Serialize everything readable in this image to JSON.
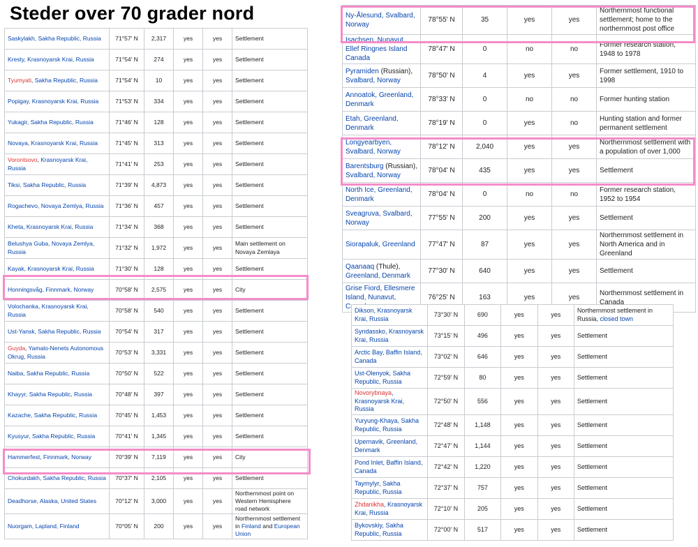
{
  "title": "Steder over 70 grader nord",
  "left_table": [
    {
      "parts": [
        {
          "t": "Saskylakh, Sakha Republic, Russia",
          "k": "link"
        }
      ],
      "lat": "71°57' N",
      "pop": "2,317",
      "a": "yes",
      "b": "yes",
      "note": [
        {
          "t": "Settlement",
          "k": "plain"
        }
      ]
    },
    {
      "parts": [
        {
          "t": "Kresty, Krasnoyarsk Krai, Russia",
          "k": "link"
        }
      ],
      "lat": "71°54' N",
      "pop": "274",
      "a": "yes",
      "b": "yes",
      "note": [
        {
          "t": "Settlement",
          "k": "plain"
        }
      ]
    },
    {
      "parts": [
        {
          "t": "Tyumyati",
          "k": "red"
        },
        {
          "t": ", Sakha Republic, Russia",
          "k": "link"
        }
      ],
      "lat": "71°54' N",
      "pop": "10",
      "a": "yes",
      "b": "yes",
      "note": [
        {
          "t": "Settlement",
          "k": "plain"
        }
      ]
    },
    {
      "parts": [
        {
          "t": "Popigay, Krasnoyarsk Krai, Russia",
          "k": "link"
        }
      ],
      "lat": "71°53' N",
      "pop": "334",
      "a": "yes",
      "b": "yes",
      "note": [
        {
          "t": "Settlement",
          "k": "plain"
        }
      ]
    },
    {
      "parts": [
        {
          "t": "Yukagir, Sakha Republic, Russia",
          "k": "link"
        }
      ],
      "lat": "71°46' N",
      "pop": "128",
      "a": "yes",
      "b": "yes",
      "note": [
        {
          "t": "Settlement",
          "k": "plain"
        }
      ]
    },
    {
      "parts": [
        {
          "t": "Novaya, Krasnoyarsk Krai, Russia",
          "k": "link"
        }
      ],
      "lat": "71°45' N",
      "pop": "313",
      "a": "yes",
      "b": "yes",
      "note": [
        {
          "t": "Settlement",
          "k": "plain"
        }
      ]
    },
    {
      "parts": [
        {
          "t": "Vorontsovo",
          "k": "red"
        },
        {
          "t": ", Krasnoyarsk Krai, Russia",
          "k": "link"
        }
      ],
      "lat": "71°41' N",
      "pop": "253",
      "a": "yes",
      "b": "yes",
      "note": [
        {
          "t": "Settlement",
          "k": "plain"
        }
      ]
    },
    {
      "parts": [
        {
          "t": "Tiksi, Sakha Republic, Russia",
          "k": "link"
        }
      ],
      "lat": "71°39' N",
      "pop": "4,873",
      "a": "yes",
      "b": "yes",
      "note": [
        {
          "t": "Settlement",
          "k": "plain"
        }
      ]
    },
    {
      "parts": [
        {
          "t": "Rogachevo, Novaya Zemlya, Russia",
          "k": "link"
        }
      ],
      "lat": "71°36' N",
      "pop": "457",
      "a": "yes",
      "b": "yes",
      "note": [
        {
          "t": "Settlement",
          "k": "plain"
        }
      ]
    },
    {
      "parts": [
        {
          "t": "Kheta, Krasnoyarsk Krai, Russia",
          "k": "link"
        }
      ],
      "lat": "71°34' N",
      "pop": "368",
      "a": "yes",
      "b": "yes",
      "note": [
        {
          "t": "Settlement",
          "k": "plain"
        }
      ]
    },
    {
      "parts": [
        {
          "t": "Belushya Guba, Novaya Zemlya, Russia",
          "k": "link"
        }
      ],
      "lat": "71°32' N",
      "pop": "1,972",
      "a": "yes",
      "b": "yes",
      "note": [
        {
          "t": "Main settlement on Novaya Zemlaya",
          "k": "plain"
        }
      ]
    },
    {
      "parts": [
        {
          "t": "Kayak, Krasnoyarsk Krai, Russia",
          "k": "link"
        }
      ],
      "lat": "71°30' N",
      "pop": "128",
      "a": "yes",
      "b": "yes",
      "note": [
        {
          "t": "Settlement",
          "k": "plain"
        }
      ]
    },
    {
      "parts": [
        {
          "t": "Honningsvåg, Finnmark, Norway",
          "k": "link"
        }
      ],
      "lat": "70°58' N",
      "pop": "2,575",
      "a": "yes",
      "b": "yes",
      "note": [
        {
          "t": "City",
          "k": "plain"
        }
      ]
    },
    {
      "parts": [
        {
          "t": "Volochanka, Krasnoyarsk Krai, Russia",
          "k": "link"
        }
      ],
      "lat": "70°58' N",
      "pop": "540",
      "a": "yes",
      "b": "yes",
      "note": [
        {
          "t": "Settlement",
          "k": "plain"
        }
      ]
    },
    {
      "parts": [
        {
          "t": "Ust-Yansk, Sakha Republic, Russia",
          "k": "link"
        }
      ],
      "lat": "70°54' N",
      "pop": "317",
      "a": "yes",
      "b": "yes",
      "note": [
        {
          "t": "Settlement",
          "k": "plain"
        }
      ]
    },
    {
      "parts": [
        {
          "t": "Guyda",
          "k": "red"
        },
        {
          "t": ", Yamalo-Nenets Autonomous Okrug, Russia",
          "k": "link"
        }
      ],
      "lat": "70°53' N",
      "pop": "3,331",
      "a": "yes",
      "b": "yes",
      "note": [
        {
          "t": "Settlement",
          "k": "plain"
        }
      ]
    },
    {
      "parts": [
        {
          "t": "Naiba, Sakha Republic, Russia",
          "k": "link"
        }
      ],
      "lat": "70°50' N",
      "pop": "522",
      "a": "yes",
      "b": "yes",
      "note": [
        {
          "t": "Settlement",
          "k": "plain"
        }
      ]
    },
    {
      "parts": [
        {
          "t": "Khayyr, Sakha Republic, Russia",
          "k": "link"
        }
      ],
      "lat": "70°48' N",
      "pop": "397",
      "a": "yes",
      "b": "yes",
      "note": [
        {
          "t": "Settlement",
          "k": "plain"
        }
      ]
    },
    {
      "parts": [
        {
          "t": "Kazache, Sakha Republic, Russia",
          "k": "link"
        }
      ],
      "lat": "70°45' N",
      "pop": "1,453",
      "a": "yes",
      "b": "yes",
      "note": [
        {
          "t": "Settlement",
          "k": "plain"
        }
      ]
    },
    {
      "parts": [
        {
          "t": "Kyusyur, Sakha Republic, Russia",
          "k": "link"
        }
      ],
      "lat": "70°41' N",
      "pop": "1,345",
      "a": "yes",
      "b": "yes",
      "note": [
        {
          "t": "Settlement",
          "k": "plain"
        }
      ]
    },
    {
      "parts": [
        {
          "t": "Hammerfest, Finnmark, Norway",
          "k": "link"
        }
      ],
      "lat": "70°39' N",
      "pop": "7,119",
      "a": "yes",
      "b": "yes",
      "note": [
        {
          "t": "City",
          "k": "plain"
        }
      ]
    },
    {
      "parts": [
        {
          "t": "Chokurdakh, Sakha Republic, Russia",
          "k": "link"
        }
      ],
      "lat": "70°37' N",
      "pop": "2,105",
      "a": "yes",
      "b": "yes",
      "note": [
        {
          "t": "Settlement",
          "k": "plain"
        }
      ]
    },
    {
      "parts": [
        {
          "t": "Deadhorse, Alaska, United States",
          "k": "link"
        }
      ],
      "lat": "70°12' N",
      "pop": "3,000",
      "a": "yes",
      "b": "yes",
      "note": [
        {
          "t": "Northernmost point on Western Hemisphere road network",
          "k": "plain"
        }
      ]
    },
    {
      "parts": [
        {
          "t": "Nuorgam, Lapland, Finland",
          "k": "link"
        }
      ],
      "lat": "70°05' N",
      "pop": "200",
      "a": "yes",
      "b": "yes",
      "note": [
        {
          "t": "Northernmost settlement in ",
          "k": "plain"
        },
        {
          "t": "Finland",
          "k": "link"
        },
        {
          "t": " and ",
          "k": "plain"
        },
        {
          "t": "European Union",
          "k": "link"
        }
      ]
    }
  ],
  "top_right_table": [
    {
      "parts": [
        {
          "t": "Ny-Ålesund, Svalbard, Norway",
          "k": "link"
        }
      ],
      "lat": "78°55' N",
      "pop": "35",
      "a": "yes",
      "b": "yes",
      "note": [
        {
          "t": "Northernmost functional settlement; home to the northernmost post office",
          "k": "plain"
        }
      ]
    },
    {
      "parts": [
        {
          "t": "Isachsen, Nunavut, Ellef Ringnes Island Canada",
          "k": "link"
        }
      ],
      "lat": "78°47' N",
      "pop": "0",
      "a": "no",
      "b": "no",
      "note": [
        {
          "t": "Former research station, 1948 to 1978",
          "k": "plain"
        }
      ]
    },
    {
      "parts": [
        {
          "t": "Pyramiden",
          "k": "link"
        },
        {
          "t": " (Russian), ",
          "k": "plain"
        },
        {
          "t": "Svalbard, Norway",
          "k": "link"
        }
      ],
      "lat": "78°50' N",
      "pop": "4",
      "a": "yes",
      "b": "yes",
      "note": [
        {
          "t": "Former settlement, 1910 to 1998",
          "k": "plain"
        }
      ]
    },
    {
      "parts": [
        {
          "t": "Annoatok, Greenland, Denmark",
          "k": "link"
        }
      ],
      "lat": "78°33' N",
      "pop": "0",
      "a": "no",
      "b": "no",
      "note": [
        {
          "t": "Former hunting station",
          "k": "plain"
        }
      ]
    },
    {
      "parts": [
        {
          "t": "Etah, Greenland, Denmark",
          "k": "link"
        }
      ],
      "lat": "78°19' N",
      "pop": "0",
      "a": "yes",
      "b": "no",
      "note": [
        {
          "t": "Hunting station and former permanent settlement",
          "k": "plain"
        }
      ]
    },
    {
      "parts": [
        {
          "t": "Longyearbyen, Svalbard, Norway",
          "k": "link"
        }
      ],
      "lat": "78°12' N",
      "pop": "2,040",
      "a": "yes",
      "b": "yes",
      "note": [
        {
          "t": "Northernmost settlement with a population of over 1,000",
          "k": "plain"
        }
      ]
    },
    {
      "parts": [
        {
          "t": "Barentsburg",
          "k": "link"
        },
        {
          "t": " (Russian), ",
          "k": "plain"
        },
        {
          "t": "Svalbard, Norway",
          "k": "link"
        }
      ],
      "lat": "78°04' N",
      "pop": "435",
      "a": "yes",
      "b": "yes",
      "note": [
        {
          "t": "Settlement",
          "k": "plain"
        }
      ]
    },
    {
      "parts": [
        {
          "t": "North Ice, Greenland, Denmark",
          "k": "link"
        }
      ],
      "lat": "78°04' N",
      "pop": "0",
      "a": "no",
      "b": "no",
      "note": [
        {
          "t": "Former research station, 1952 to 1954",
          "k": "plain"
        }
      ]
    },
    {
      "parts": [
        {
          "t": "Sveagruva, Svalbard, Norway",
          "k": "link"
        }
      ],
      "lat": "77°55' N",
      "pop": "200",
      "a": "yes",
      "b": "yes",
      "note": [
        {
          "t": "Settlement",
          "k": "plain"
        }
      ]
    },
    {
      "parts": [
        {
          "t": "Siorapaluk, Greenland",
          "k": "link"
        }
      ],
      "lat": "77°47' N",
      "pop": "87",
      "a": "yes",
      "b": "yes",
      "note": [
        {
          "t": "Northernmost settlement in North America and in Greenland",
          "k": "plain"
        }
      ]
    },
    {
      "parts": [
        {
          "t": "Qaanaaq",
          "k": "link"
        },
        {
          "t": " (Thule), ",
          "k": "plain"
        },
        {
          "t": "Greenland, Denmark",
          "k": "link"
        }
      ],
      "lat": "77°30' N",
      "pop": "640",
      "a": "yes",
      "b": "yes",
      "note": [
        {
          "t": "Settlement",
          "k": "plain"
        }
      ]
    },
    {
      "parts": [
        {
          "t": "Grise Fiord, Ellesmere Island, Nunavut, Canada",
          "k": "link"
        }
      ],
      "lat": "76°25' N",
      "pop": "163",
      "a": "yes",
      "b": "yes",
      "note": [
        {
          "t": "Northernmost settlement in Canada",
          "k": "plain"
        }
      ]
    }
  ],
  "bottom_right_table": [
    {
      "parts": [
        {
          "t": "Dikson, Krasnoyarsk Krai, Russia",
          "k": "link"
        }
      ],
      "lat": "73°30' N",
      "pop": "690",
      "a": "yes",
      "b": "yes",
      "note": [
        {
          "t": "Northernmost settlement in Russia, ",
          "k": "plain"
        },
        {
          "t": "closed town",
          "k": "link"
        }
      ]
    },
    {
      "parts": [
        {
          "t": "Syndassko, Krasnoyarsk Krai, Russia",
          "k": "link"
        }
      ],
      "lat": "73°15' N",
      "pop": "496",
      "a": "yes",
      "b": "yes",
      "note": [
        {
          "t": "Settlement",
          "k": "plain"
        }
      ]
    },
    {
      "parts": [
        {
          "t": "Arctic Bay, Baffin Island, Canada",
          "k": "link"
        }
      ],
      "lat": "73°02' N",
      "pop": "646",
      "a": "yes",
      "b": "yes",
      "note": [
        {
          "t": "Settlement",
          "k": "plain"
        }
      ]
    },
    {
      "parts": [
        {
          "t": "Ust-Olenyok, Sakha Republic, Russia",
          "k": "link"
        }
      ],
      "lat": "72°59' N",
      "pop": "80",
      "a": "yes",
      "b": "yes",
      "note": [
        {
          "t": "Settlement",
          "k": "plain"
        }
      ]
    },
    {
      "parts": [
        {
          "t": "Novorybnaya",
          "k": "red"
        },
        {
          "t": ", Krasnoyarsk Krai, Russia",
          "k": "link"
        }
      ],
      "lat": "72°50' N",
      "pop": "556",
      "a": "yes",
      "b": "yes",
      "note": [
        {
          "t": "Settlement",
          "k": "plain"
        }
      ]
    },
    {
      "parts": [
        {
          "t": "Yuryung-Khaya, Sakha Republic, Russia",
          "k": "link"
        }
      ],
      "lat": "72°48' N",
      "pop": "1,148",
      "a": "yes",
      "b": "yes",
      "note": [
        {
          "t": "Settlement",
          "k": "plain"
        }
      ]
    },
    {
      "parts": [
        {
          "t": "Upernavik, Greenland, Denmark",
          "k": "link"
        }
      ],
      "lat": "72°47' N",
      "pop": "1,144",
      "a": "yes",
      "b": "yes",
      "note": [
        {
          "t": "Settlement",
          "k": "plain"
        }
      ]
    },
    {
      "parts": [
        {
          "t": "Pond Inlet, Baffin Island, Canada",
          "k": "link"
        }
      ],
      "lat": "72°42' N",
      "pop": "1,220",
      "a": "yes",
      "b": "yes",
      "note": [
        {
          "t": "Settlement",
          "k": "plain"
        }
      ]
    },
    {
      "parts": [
        {
          "t": "Taymylyr, Sakha Republic, Russia",
          "k": "link"
        }
      ],
      "lat": "72°37' N",
      "pop": "757",
      "a": "yes",
      "b": "yes",
      "note": [
        {
          "t": "Settlement",
          "k": "plain"
        }
      ]
    },
    {
      "parts": [
        {
          "t": "Zhdanikha",
          "k": "red"
        },
        {
          "t": ", Krasnoyarsk Krai, Russia",
          "k": "link"
        }
      ],
      "lat": "72°10' N",
      "pop": "205",
      "a": "yes",
      "b": "yes",
      "note": [
        {
          "t": "Settlement",
          "k": "plain"
        }
      ]
    },
    {
      "parts": [
        {
          "t": "Bykovskiy, Sakha Republic, Russia",
          "k": "link"
        }
      ],
      "lat": "72°00' N",
      "pop": "517",
      "a": "yes",
      "b": "yes",
      "note": [
        {
          "t": "Settlement",
          "k": "plain"
        }
      ]
    }
  ],
  "colors": {
    "link": "#0645ad",
    "redlink": "#dd3333",
    "highlight": "#f48cc8",
    "border": "#c8ccd1"
  }
}
